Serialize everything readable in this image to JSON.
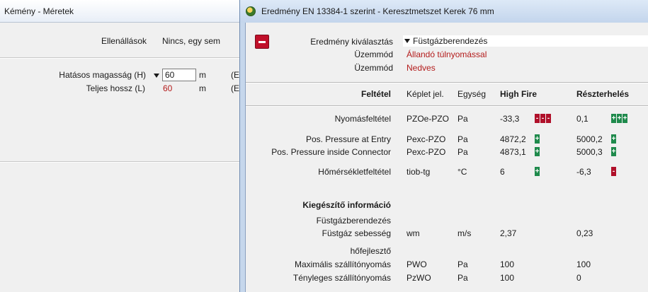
{
  "bg_window": {
    "title": "Kémény - Méretek",
    "resistances_label": "Ellenállások",
    "resistances_value": "Nincs, egy sem",
    "height_label": "Hatásos magasság (H)",
    "height_value": "60",
    "height_unit": "m",
    "height_suffix": "(E",
    "length_label": "Teljes hossz (L)",
    "length_value": "60",
    "length_unit": "m",
    "length_suffix": "(E"
  },
  "dialog": {
    "title": "Eredmény EN 13384-1 szerint - Keresztmetszet Kerek 76 mm",
    "selection_label": "Eredmény kiválasztás",
    "selection_value": "Füstgázberendezés",
    "mode1_label": "Üzemmód",
    "mode1_value": "Állandó túlnyomással",
    "mode2_label": "Üzemmód",
    "mode2_value": "Nedves",
    "headers": {
      "condition": "Feltétel",
      "formula": "Képlet jel.",
      "unit": "Egység",
      "high_fire": "High Fire",
      "partial_load": "Részterhelés"
    },
    "rows": [
      {
        "label": "Nyomásfeltétel",
        "formula": "PZOe-PZO",
        "unit": "Pa",
        "hf": "-33,3",
        "hf_badge": "---",
        "hf_color": "red",
        "pl": "0,1",
        "pl_badge": "+++",
        "pl_color": "green"
      },
      {
        "label": "Pos. Pressure at Entry",
        "formula": "Pexc-PZO",
        "unit": "Pa",
        "hf": "4872,2",
        "hf_badge": "+",
        "hf_color": "green",
        "pl": "5000,2",
        "pl_badge": "+",
        "pl_color": "green"
      },
      {
        "label": "Pos. Pressure inside Connector",
        "formula": "Pexc-PZO",
        "unit": "Pa",
        "hf": "4873,1",
        "hf_badge": "+",
        "hf_color": "green",
        "pl": "5000,3",
        "pl_badge": "+",
        "pl_color": "green"
      },
      {
        "label": "Hőmérsékletfeltétel",
        "formula": "tiob-tg",
        "unit": "°C",
        "hf": "6",
        "hf_badge": "+",
        "hf_color": "green",
        "pl": "-6,3",
        "pl_badge": "-",
        "pl_color": "red"
      }
    ],
    "extra_title": "Kiegészítő információ",
    "extra_groups": [
      {
        "group": "Füstgázberendezés",
        "label": "Füstgáz sebesség",
        "formula": "wm",
        "unit": "m/s",
        "hf": "2,37",
        "pl": "0,23"
      },
      {
        "group": "hőfejlesztő",
        "label": "Maximális szállítónyomás",
        "formula": "PWO",
        "unit": "Pa",
        "hf": "100",
        "pl": "100"
      },
      {
        "group": "",
        "label": "Tényleges szállítónyomás",
        "formula": "PzWO",
        "unit": "Pa",
        "hf": "100",
        "pl": "0"
      }
    ],
    "colors": {
      "accent_red": "#b31b1b",
      "badge_green": "#1f8a4c",
      "badge_red": "#b0102a"
    }
  }
}
